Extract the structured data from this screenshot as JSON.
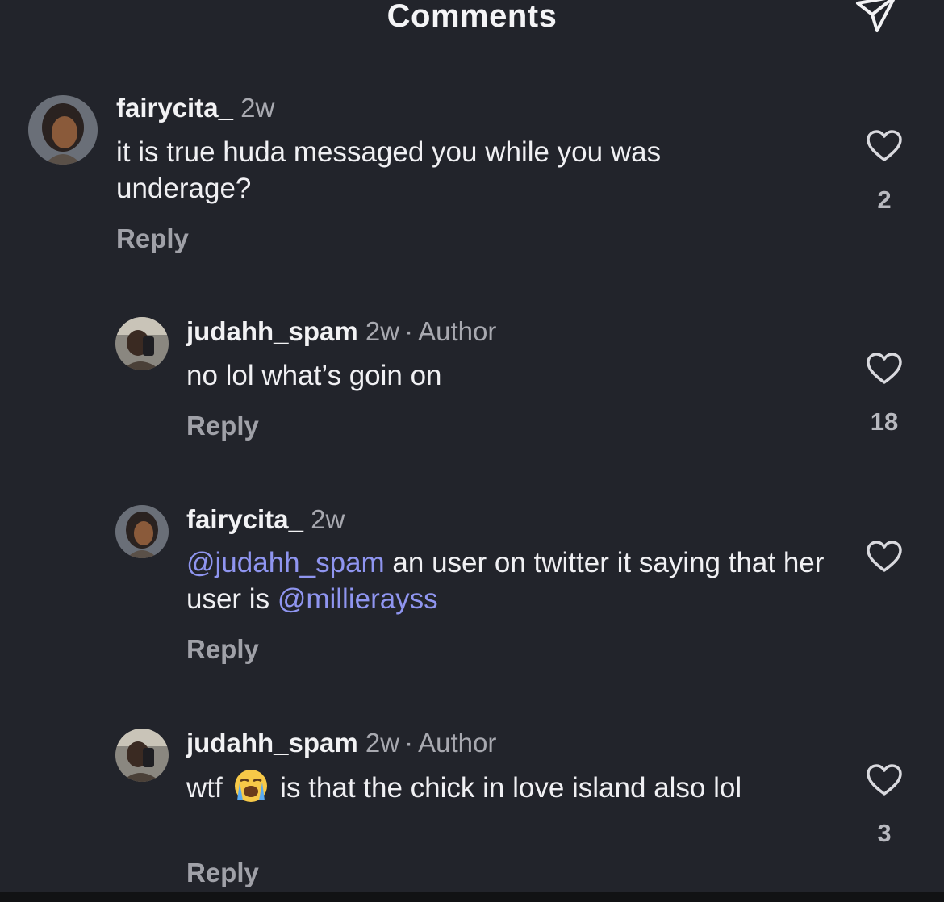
{
  "header": {
    "title": "Comments",
    "share_icon": "paper-plane-icon"
  },
  "comments": [
    {
      "username": "fairycita_",
      "time": "2w",
      "author_badge": "",
      "text_parts": [
        "it is true huda messaged you while you was underage?"
      ],
      "reply_label": "Reply",
      "likes": "2",
      "avatar": "cartoon-avatar"
    },
    {
      "username": "judahh_spam",
      "time": "2w",
      "separator": "·",
      "author_badge": "Author",
      "text_parts": [
        "no lol what’s goin on"
      ],
      "reply_label": "Reply",
      "likes": "18",
      "avatar": "photo-avatar"
    },
    {
      "username": "fairycita_",
      "time": "2w",
      "author_badge": "",
      "mention_1": "@judahh_spam",
      "text_mid": " an user on twitter it saying that her user is ",
      "mention_2": "@millierayss",
      "reply_label": "Reply",
      "likes": "",
      "avatar": "cartoon-avatar"
    },
    {
      "username": "judahh_spam",
      "time": "2w",
      "separator": "·",
      "author_badge": "Author",
      "text_before_emoji": "wtf ",
      "emoji": "loudly-crying-face-icon",
      "text_after_emoji": " is that the chick in love island also lol",
      "reply_label": "Reply",
      "likes": "3",
      "avatar": "photo-avatar"
    }
  ],
  "colors": {
    "background": "#22242b",
    "mention": "#8f95f0",
    "secondary_text": "#a8a9b0"
  }
}
